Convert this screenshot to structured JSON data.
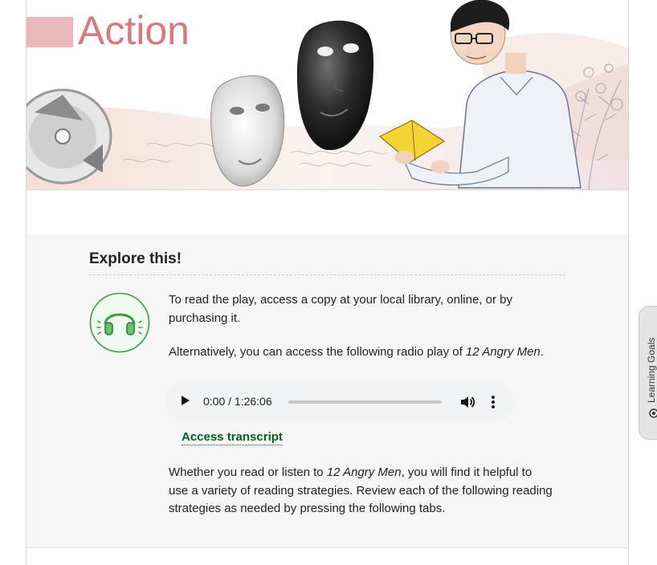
{
  "banner": {
    "title": "Action"
  },
  "explore": {
    "title": "Explore this!",
    "icon": "headphones-icon",
    "paragraph1": "To read the play, access a copy at your local library, online, or by purchasing it.",
    "paragraph2_prefix": "Alternatively, you can access the following radio play of ",
    "paragraph2_italic": "12 Angry Men",
    "paragraph2_suffix": ".",
    "paragraph3_prefix": "Whether you read or listen to ",
    "paragraph3_italic": "12 Angry Men",
    "paragraph3_suffix": ", you will find it helpful to use a variety of reading strategies. Review each of the following reading strategies as needed by pressing the following tabs."
  },
  "audio": {
    "current_time": "0:00",
    "duration": "1:26:06",
    "time_display": "0:00 / 1:26:06",
    "progress_fraction": 0
  },
  "transcript": {
    "label": "Access transcript"
  },
  "side_tab": {
    "label": "Learning Goals",
    "icon": "target-icon"
  },
  "colors": {
    "accent_title": "#d9797e",
    "heading_block": "#e8b8bb",
    "link": "#0b5d1e",
    "icon_green": "#3b9a47"
  }
}
